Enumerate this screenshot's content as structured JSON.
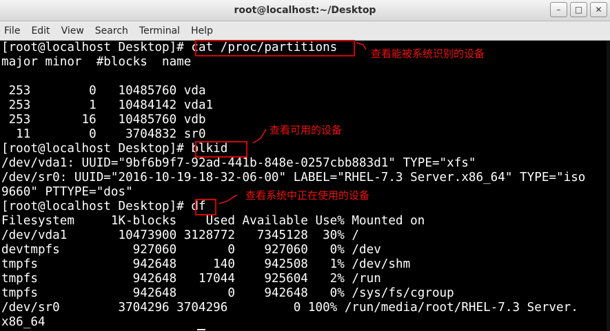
{
  "window": {
    "title": "root@localhost:~/Desktop",
    "minimize": "–",
    "maximize": "□",
    "close": "✕"
  },
  "menu": [
    "File",
    "Edit",
    "View",
    "Search",
    "Terminal",
    "Help"
  ],
  "terminal": {
    "prompt": "[root@localhost Desktop]# ",
    "lines": [
      "[root@localhost Desktop]# cat /proc/partitions",
      "major minor  #blocks  name",
      "",
      " 253        0   10485760 vda",
      " 253        1   10484142 vda1",
      " 253       16   10485760 vdb",
      "  11        0    3704832 sr0",
      "[root@localhost Desktop]# blkid",
      "/dev/vda1: UUID=\"9bf6b9f7-92ad-441b-848e-0257cbb883d1\" TYPE=\"xfs\"",
      "/dev/sr0: UUID=\"2016-10-19-18-32-06-00\" LABEL=\"RHEL-7.3 Server.x86_64\" TYPE=\"iso",
      "9660\" PTTYPE=\"dos\"",
      "[root@localhost Desktop]# df",
      "Filesystem     1K-blocks    Used Available Use% Mounted on",
      "/dev/vda1       10473900 3128772   7345128  30% /",
      "devtmpfs          927060       0    927060   0% /dev",
      "tmpfs             942648     140    942508   1% /dev/shm",
      "tmpfs             942648   17044    925604   2% /run",
      "tmpfs             942648       0    942648   0% /sys/fs/cgroup",
      "/dev/sr0        3704296 3704296         0 100% /run/media/root/RHEL-7.3 Server.",
      "x86_64"
    ]
  },
  "annotations": [
    {
      "text": "查看能被系统识别的设备"
    },
    {
      "text": "查看可用的设备"
    },
    {
      "text": "查看系统中正在使用的设备"
    }
  ],
  "colors": {
    "background": "#000000",
    "text": "#ffffff",
    "annotation": "#f01010"
  }
}
